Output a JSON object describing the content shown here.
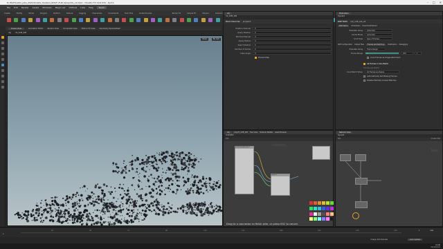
{
  "window": {
    "title": "D:/3D/Houdini_jobs_2021/Scripts_Clusters_RCK/F_FLIP_Spray/Vol_v1.hiplc - Houdini FX 19.0.531 - Py3.9",
    "controls": [
      "–",
      "□",
      "✕"
    ]
  },
  "menu": [
    "File",
    "Edit",
    "Render",
    "Assets",
    "Windows",
    "Magic.net",
    "VDTools",
    "Labs",
    "Help",
    "Build"
  ],
  "shelf_tabs": [
    "Create",
    "Modify",
    "Model",
    "Polygon",
    "Deform",
    "Texture",
    "Rigging",
    "Characters",
    "Constraints",
    "Hair Utils",
    "Guide Process",
    "Terrain FX",
    "Simple FX",
    "Volume",
    "Collisions",
    "Particles",
    "Grains",
    "Vellum",
    "Rigid Bodies",
    "Particle Fluids",
    "Viscous Fluids",
    "Oceans"
  ],
  "viewport": {
    "tabs": [
      "Scene View",
      "Animation Editor",
      "Render View",
      "Composite View",
      "Motion FX View",
      "Geometry Spreadsheet"
    ],
    "path_label": "obj",
    "path_node": "VS_VDB_SIM",
    "camera_btn": "Persp",
    "display_btn": "No cam"
  },
  "params_panel": {
    "header": "Point Cloud Iso",
    "node_name": "pcopen1",
    "rows": [
      {
        "label": "Position Channel",
        "value": "P"
      },
      {
        "label": "Query Position",
        "value": "0"
      },
      {
        "label": "Normal Channel",
        "value": "0"
      },
      {
        "label": "Query Radius",
        "value": "0"
      },
      {
        "label": "Search Radius",
        "value": "0"
      },
      {
        "label": "Number of points",
        "value": "0"
      },
      {
        "label": "Cube Angle",
        "value": "0"
      }
    ],
    "checkbox_label": "Preload Map"
  },
  "rop_panel": {
    "header": "ROP Fetch",
    "node_name": "rop_vdb_out_v2",
    "tabs": [
      "ROP Fetch",
      "Schedulers",
      "Download/Upload"
    ],
    "rows": [
      {
        "label": "Evaluate Using",
        "value": "Automatic"
      },
      {
        "label": "Cache Mode",
        "value": "Automatic"
      },
      {
        "label": "Cook Type",
        "value": "Type of Frames"
      }
    ],
    "subtabs": [
      "ROP Configuration",
      "Output Files",
      "Frames and Batching",
      "Distribution",
      "Debugging"
    ],
    "evaluate_using_label": "Evaluate Using",
    "frame_range_value": "Frame Range",
    "frame_range_label": "Frame Range",
    "frame_start": "1",
    "frame_end": "250",
    "frame_inc": "1",
    "cook_frames_label": "Cook Frames as Single Work Item",
    "all_frames_label": "All Frames in One Batch",
    "batch_section": "Frames per Batch",
    "cook_when_label": "Cook Batch When",
    "cook_when_value": "All Frames are Ready",
    "auto_frames_label": "Automatically Set Missing Frames",
    "disable_label": "Disable Partially Cooked Batches"
  },
  "network_left": {
    "tabs": [
      "obj",
      "/obj/VS_VDB_SIM",
      "Tree View",
      "Material Palette",
      "Asset Browser"
    ],
    "path_node": "Vol3mHkt",
    "msg": "Drag to a connector to finish wire, or press ESC to cancel.",
    "title": "Geometry",
    "node_a_title": "geometry/sop/pcopen1",
    "node_b_title": "pcopen1"
  },
  "network_right": {
    "tabs": [
      "Network View",
      "Parameters"
    ],
    "path_node": "topnet1",
    "title": "Tasks",
    "status_text": "0 tasks total",
    "node_labels": [
      "ropfetch1",
      "wedge1",
      "pythonscript1",
      "rop_vdb_out_v2"
    ]
  },
  "timeline": {
    "frame": "1",
    "start": "1",
    "end": "240",
    "ticks": [
      "24",
      "48",
      "72",
      "96",
      "120",
      "144",
      "168",
      "192",
      "216",
      "240"
    ]
  },
  "statusbar": {
    "auto_update": "Auto Update",
    "keys": "0 keys, 0/0 channels"
  },
  "colors": {
    "accent": "#e8a030",
    "selected": "#4c8fb8",
    "teal": "#3d8f8a",
    "sky_top": "#687f8e",
    "sky_bottom": "#b9c5c9"
  },
  "taskbar": {
    "time": "12:00",
    "date": "04/26/2022"
  }
}
